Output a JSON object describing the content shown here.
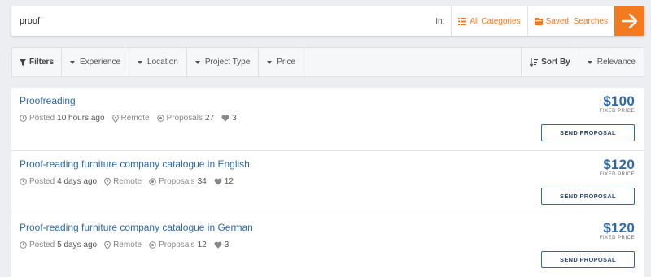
{
  "search": {
    "query": "proof",
    "in_label": "In:",
    "categories_label": "All Categories",
    "saved_label": "Saved Searches",
    "accent": "#f47a20"
  },
  "filters": {
    "filters_label": "Filters",
    "experience_label": "Experience",
    "location_label": "Location",
    "project_type_label": "Project Type",
    "price_label": "Price",
    "sort_label": "Sort By",
    "relevance_label": "Relevance"
  },
  "jobs": [
    {
      "title": "Proofreading",
      "posted_label": "Posted",
      "posted": "10 hours ago",
      "location": "Remote",
      "proposals_label": "Proposals",
      "proposals": "27",
      "likes": "3",
      "price": "$100",
      "price_type": "FIXED PRICE",
      "button": "SEND PROPOSAL"
    },
    {
      "title": "Proof-reading furniture company catalogue in English",
      "posted_label": "Posted",
      "posted": "4 days ago",
      "location": "Remote",
      "proposals_label": "Proposals",
      "proposals": "34",
      "likes": "12",
      "price": "$120",
      "price_type": "FIXED PRICE",
      "button": "SEND PROPOSAL"
    },
    {
      "title": "Proof-reading furniture company catalogue in German",
      "posted_label": "Posted",
      "posted": "5 days ago",
      "location": "Remote",
      "proposals_label": "Proposals",
      "proposals": "12",
      "likes": "3",
      "price": "$120",
      "price_type": "FIXED PRICE",
      "button": "SEND PROPOSAL"
    }
  ],
  "colors": {
    "link_blue": "#2e69a8",
    "accent_orange": "#f47a20",
    "background": "#eceef1"
  }
}
